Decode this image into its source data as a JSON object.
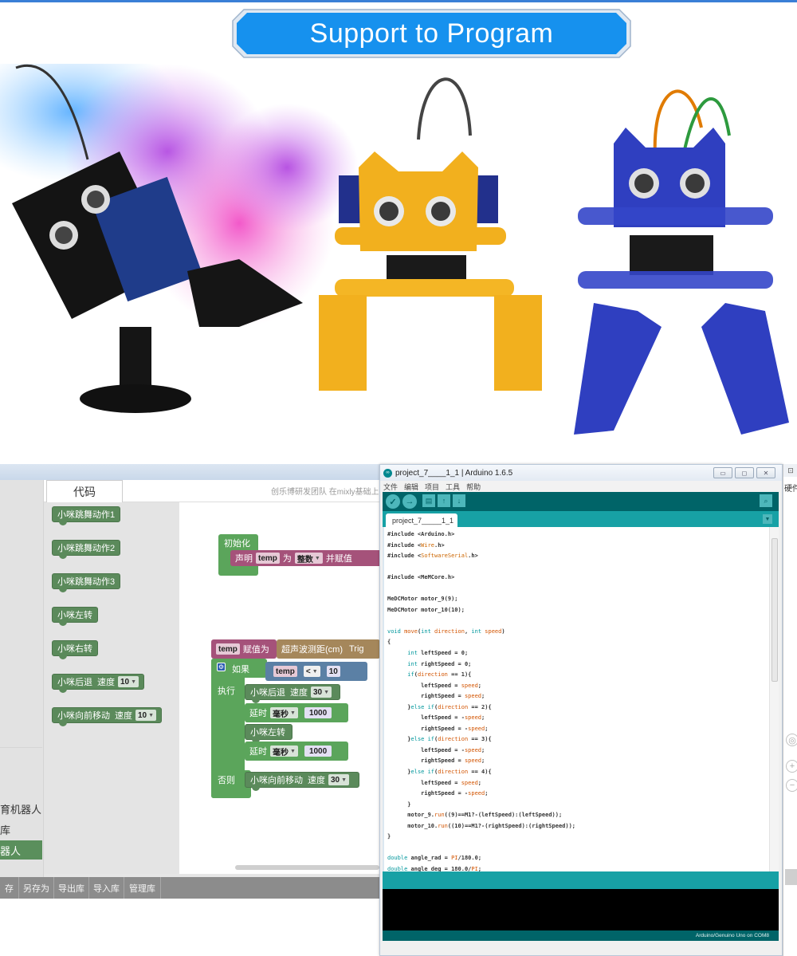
{
  "banner": {
    "title": "Support to Program"
  },
  "photo": {
    "robots": [
      {
        "name": "black cat robot",
        "color": "#1a1a1a"
      },
      {
        "name": "yellow cat robot",
        "color": "#f2b01e"
      },
      {
        "name": "blue cat robot",
        "color": "#2f3fc0"
      }
    ]
  },
  "mixly": {
    "tab_label": "代码",
    "credit": "创乐博研发团队 在mixly基础上",
    "categories": [
      {
        "label": "育机器人",
        "active": false
      },
      {
        "label": "库",
        "active": false
      },
      {
        "label": "器人",
        "active": true
      }
    ],
    "palette_blocks": [
      {
        "label": "小咪跳舞动作1"
      },
      {
        "label": "小咪跳舞动作2"
      },
      {
        "label": "小咪跳舞动作3"
      },
      {
        "label": "小咪左转"
      },
      {
        "label": "小咪右转"
      },
      {
        "label": "小咪后退",
        "param_label": "速度",
        "value": "10"
      },
      {
        "label": "小咪向前移动",
        "param_label": "速度",
        "value": "10"
      }
    ],
    "workspace": {
      "init_block": "初始化",
      "declare": {
        "label": "声明",
        "var": "temp",
        "as": "为",
        "type": "整数",
        "assign": "并赋值"
      },
      "assign": {
        "var": "temp",
        "label": "赋值为",
        "sensor": "超声波测距(cm)",
        "sensor_suffix": "Trig"
      },
      "if_block": {
        "if_label": "如果",
        "cond_var": "temp",
        "cond_op": "<",
        "cond_value": "10",
        "do_label": "执行",
        "else_label": "否则",
        "do_steps": [
          {
            "type": "move",
            "label": "小咪后退",
            "param_label": "速度",
            "value": "30"
          },
          {
            "type": "delay",
            "label": "延时",
            "unit": "毫秒",
            "value": "1000"
          },
          {
            "type": "action",
            "label": "小咪左转"
          },
          {
            "type": "delay",
            "label": "延时",
            "unit": "毫秒",
            "value": "1000"
          }
        ],
        "else_step": {
          "label": "小咪向前移动",
          "param_label": "速度",
          "value": "30"
        }
      }
    },
    "bottom_buttons": [
      "存",
      "另存为",
      "导出库",
      "导入库",
      "管理库"
    ]
  },
  "ide": {
    "title": "project_7____1_1 | Arduino 1.6.5",
    "window_buttons": [
      "▭",
      "◻",
      "✕"
    ],
    "menu": [
      "文件",
      "编辑",
      "项目",
      "工具",
      "帮助"
    ],
    "toolbar": [
      {
        "name": "verify",
        "glyph": "✓"
      },
      {
        "name": "upload",
        "glyph": "→"
      },
      {
        "name": "new",
        "glyph": "▤"
      },
      {
        "name": "open",
        "glyph": "↑"
      },
      {
        "name": "save",
        "glyph": "↓"
      }
    ],
    "serial_monitor_glyph": "⌕",
    "tab_label": "project_7_____1_1",
    "tab_menu_glyph": "▼",
    "code_lines": [
      "#include <Arduino.h>",
      "#include <Wire.h>",
      "#include <SoftwareSerial.h>",
      "",
      "#include <MeMCore.h>",
      "",
      "MeDCMotor motor_9(9);",
      "MeDCMotor motor_10(10);",
      "",
      "void move(int direction, int speed)",
      "{",
      "      int leftSpeed = 0;",
      "      int rightSpeed = 0;",
      "      if(direction == 1){",
      "          leftSpeed = speed;",
      "          rightSpeed = speed;",
      "      }else if(direction == 2){",
      "          leftSpeed = -speed;",
      "          rightSpeed = -speed;",
      "      }else if(direction == 3){",
      "          leftSpeed = -speed;",
      "          rightSpeed = speed;",
      "      }else if(direction == 4){",
      "          leftSpeed = speed;",
      "          rightSpeed = -speed;",
      "      }",
      "      motor_9.run((9)==M1?-(leftSpeed):(leftSpeed));",
      "      motor_10.run((10)==M1?-(rightSpeed):(rightSpeed));",
      "}",
      "",
      "double angle_rad = PI/180.0;",
      "double angle_deg = 180.0/PI;"
    ],
    "status_footer": "Arduino/Genuino Uno on COM8"
  },
  "sliver": {
    "top_glyph": "⊡",
    "text": "硬件单",
    "controls": [
      "◎",
      "+",
      "−"
    ]
  },
  "colors": {
    "banner_blue": "#1691ee",
    "arduino_dark": "#006468",
    "arduino_teal": "#17a1a5",
    "block_green": "#5b8a5b",
    "block_pink": "#a5527a"
  }
}
